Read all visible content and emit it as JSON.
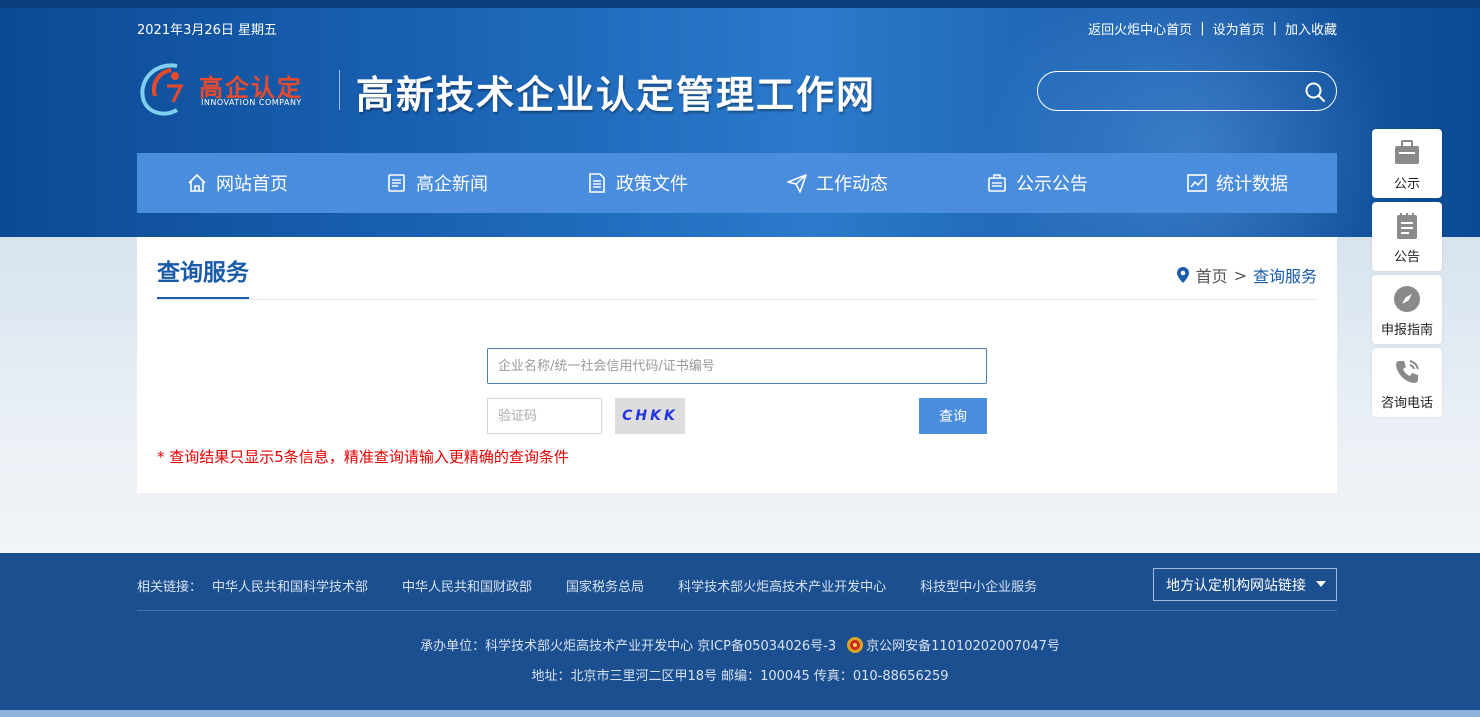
{
  "topbar": {
    "date": "2021年3月26日 星期五",
    "links": [
      "返回火炬中心首页",
      "设为首页",
      "加入收藏"
    ],
    "separator": "|"
  },
  "logo": {
    "cn_text": "高企认定",
    "en_text": "INNOVATION COMPANY"
  },
  "site_title": "高新技术企业认定管理工作网",
  "search": {
    "placeholder": "",
    "icon": "search-icon"
  },
  "nav": [
    {
      "label": "网站首页",
      "icon": "home-icon"
    },
    {
      "label": "高企新闻",
      "icon": "news-icon"
    },
    {
      "label": "政策文件",
      "icon": "document-icon"
    },
    {
      "label": "工作动态",
      "icon": "send-icon"
    },
    {
      "label": "公示公告",
      "icon": "notice-icon"
    },
    {
      "label": "统计数据",
      "icon": "chart-icon"
    }
  ],
  "page": {
    "title": "查询服务",
    "breadcrumb": {
      "home": "首页",
      "separator": ">",
      "current": "查询服务"
    },
    "query_placeholder": "企业名称/统一社会信用代码/证书编号",
    "captcha_placeholder": "验证码",
    "captcha_text": "CHKK",
    "query_button": "查询",
    "notice": "* 查询结果只显示5条信息，精准查询请输入更精确的查询条件"
  },
  "side_panel": [
    {
      "label": "公示",
      "icon": "briefcase-icon"
    },
    {
      "label": "公告",
      "icon": "notepad-icon"
    },
    {
      "label": "申报指南",
      "icon": "compass-icon"
    },
    {
      "label": "咨询电话",
      "icon": "phone-icon"
    }
  ],
  "footer": {
    "links_label": "相关链接：",
    "links": [
      "中华人民共和国科学技术部",
      "中华人民共和国财政部",
      "国家税务总局",
      "科学技术部火炬高技术产业开发中心",
      "科技型中小企业服务"
    ],
    "local_select": "地方认定机构网站链接",
    "line1_text": "承办单位：科学技术部火炬高技术产业开发中心 京ICP备05034026号-3",
    "line1_police": "京公网安备11010202007047号",
    "line2": "地址：北京市三里河二区甲18号 邮编：100045 传真：010-88656259"
  },
  "colors": {
    "primary": "#1a5ba9",
    "nav_bg": "#4a8ddc",
    "footer_bg": "#1c4f8f",
    "notice": "#e60000"
  }
}
